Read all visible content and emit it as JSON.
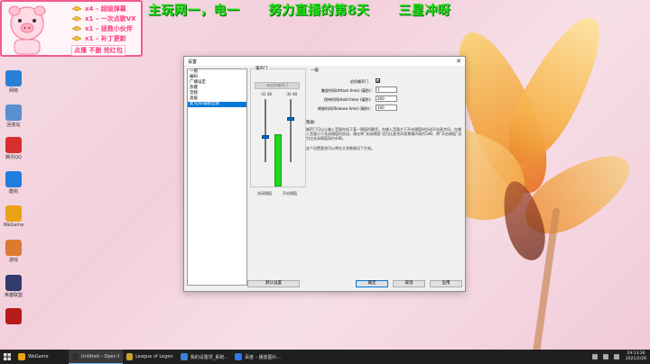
{
  "overlay": {
    "donations": [
      {
        "text": "x4 – 超级弹幕"
      },
      {
        "text": "x1 – 一次点歌VX"
      },
      {
        "text": "x1 – 拯救小伙伴"
      },
      {
        "text": "x1 – 补丁更新"
      }
    ],
    "notice": "点播 不删 抢红包",
    "banner": [
      "主玩网一，电一",
      "努力直播的第8天",
      "三星冲呀"
    ]
  },
  "desktop_icons": [
    {
      "name": "network-icon",
      "label": "网络",
      "color": "#2a7fd4"
    },
    {
      "name": "recycle-bin-icon",
      "label": "回收站",
      "color": "#5a8fd0"
    },
    {
      "name": "qq-icon",
      "label": "腾讯QQ",
      "color": "#d72e2e"
    },
    {
      "name": "kugou-icon",
      "label": "酷狗",
      "color": "#1f7de0"
    },
    {
      "name": "wegame-icon",
      "label": "WeGame",
      "color": "#e8a316"
    },
    {
      "name": "game-icon",
      "label": "游戏",
      "color": "#dd7b30"
    },
    {
      "name": "lol-icon",
      "label": "英雄联盟",
      "color": "#333a6e"
    },
    {
      "name": "blood-icon",
      "label": "",
      "color": "#b81b1b"
    }
  ],
  "dialog": {
    "title": "设置",
    "nav_items": [
      "一般",
      "编码",
      "广播设定",
      "热键",
      "音频",
      "高级",
      "麦克风/辅助音频"
    ],
    "selected_nav": 6,
    "mixer": {
      "group_title": "噪声门",
      "meter_button": "未启用噪声门",
      "left_db": "-41 dB",
      "right_db": "-36 dB",
      "left_caption": "关闭阈值",
      "right_caption": "开启阈值",
      "level_percent": 60
    },
    "general": {
      "title": "一般",
      "enable_label": "启用噪声门",
      "enable_checked": true,
      "attack_label": "触发时间(Attack time) (毫秒):",
      "attack_value": "1",
      "hold_label": "保持时间(Hold time) (毫秒):",
      "hold_value": "200",
      "release_label": "释放时间(Release time) (毫秒):",
      "release_value": "100"
    },
    "help": {
      "title": "帮助:",
      "body": "噪声门可以让输入音量在低于某一阈值时静音，在输入音量大于开启阈值时自动开启麦克风，在输入音量小于关闭阈值时关闭。建议将“关闭阈值”设为比麦克风背景噪声高约5dB，将“开启阈值”设为比关闭阈值高约4dB。",
      "warning": "这个设置更改可以将在大多数情况下生效。"
    },
    "buttons": {
      "defaults": "默认设置",
      "ok": "确定",
      "cancel": "取消",
      "apply": "应用"
    }
  },
  "taskbar": {
    "items": [
      {
        "label": "WeGame",
        "color": "#e8a316"
      },
      {
        "label": "Untitled – Open B...",
        "color": "#303030"
      },
      {
        "label": "League of Legends",
        "color": "#c8a030"
      },
      {
        "label": "我的设置项_系统...",
        "color": "#3a82d8"
      },
      {
        "label": "百度 – 播放图片...",
        "color": "#2f78e8"
      }
    ],
    "active_index": 1,
    "time": "19:13:26",
    "date": "2021/2/26"
  }
}
